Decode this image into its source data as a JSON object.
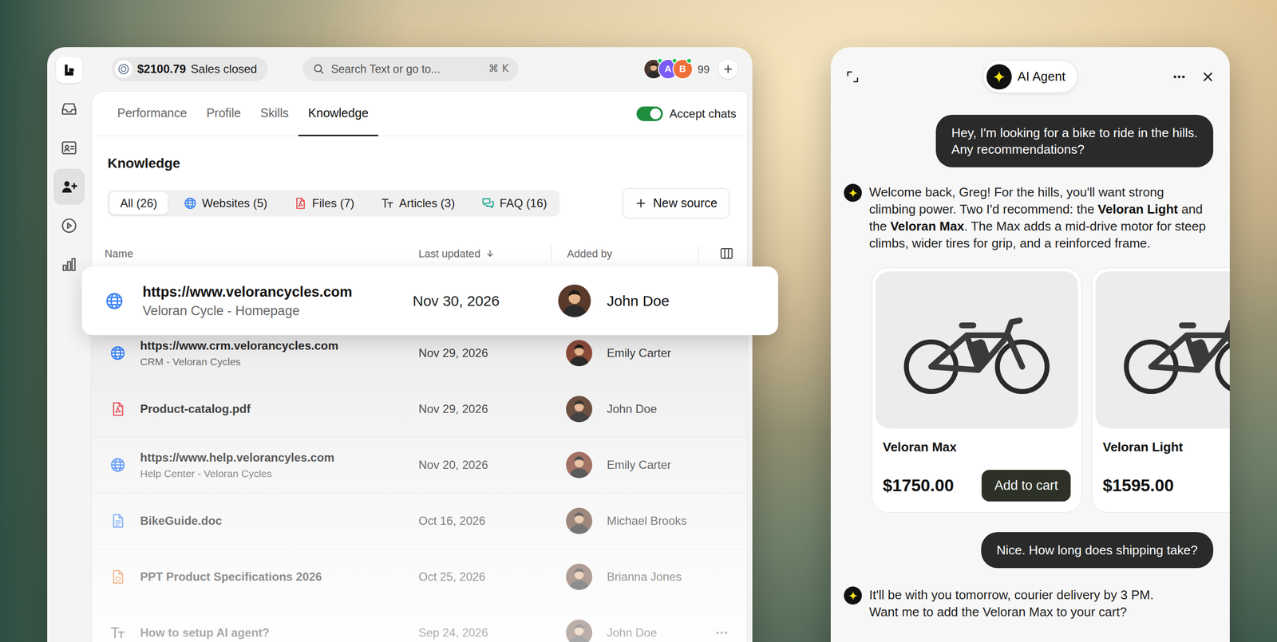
{
  "topbar": {
    "sales": {
      "amount": "$2100.79",
      "label": "Sales closed"
    },
    "search": {
      "placeholder": "Search Text or go to...",
      "shortcut": "⌘ K"
    },
    "avatars": [
      {
        "kind": "photo",
        "online": true
      },
      {
        "kind": "letter",
        "letter": "A",
        "color": "#7c5cf5",
        "online": true
      },
      {
        "kind": "letter",
        "letter": "B",
        "color": "#f0703a",
        "online": true
      }
    ],
    "avatar_count": "99"
  },
  "sidebar": {
    "items": [
      {
        "selected": false
      },
      {
        "selected": false
      },
      {
        "selected": true
      },
      {
        "selected": false
      },
      {
        "selected": false
      }
    ]
  },
  "tabs": [
    {
      "label": "Performance",
      "selected": false
    },
    {
      "label": "Profile",
      "selected": false
    },
    {
      "label": "Skills",
      "selected": false
    },
    {
      "label": "Knowledge",
      "selected": true
    }
  ],
  "accept_chats": {
    "label": "Accept chats",
    "on": true
  },
  "knowledge": {
    "title": "Knowledge",
    "filters": [
      {
        "label": "All (26)",
        "selected": true
      },
      {
        "label": "Websites (5)",
        "selected": false,
        "kind": "website"
      },
      {
        "label": "Files (7)",
        "selected": false,
        "kind": "file"
      },
      {
        "label": "Articles (3)",
        "selected": false,
        "kind": "article"
      },
      {
        "label": "FAQ (16)",
        "selected": false,
        "kind": "faq"
      }
    ],
    "new_source": "New source"
  },
  "table": {
    "columns": [
      {
        "label": "Name",
        "sort": "none"
      },
      {
        "label": "Last updated",
        "sort": "desc"
      },
      {
        "label": "Added by",
        "sort": "none"
      }
    ],
    "rows": [
      {
        "kind": "website",
        "name": "https://www.velorancycles.com",
        "subtitle": "Veloran Cycle - Homepage",
        "updated": "Nov 30, 2026",
        "added_by": "John Doe",
        "selected": true,
        "actions_visible": false
      },
      {
        "kind": "website",
        "name": "https://www.crm.velorancycles.com",
        "subtitle": "CRM - Veloran Cycles",
        "updated": "Nov 29, 2026",
        "added_by": "Emily Carter",
        "selected": false,
        "actions_visible": false
      },
      {
        "kind": "pdf",
        "name": "Product-catalog.pdf",
        "updated": "Nov 29, 2026",
        "added_by": "John Doe",
        "selected": false,
        "actions_visible": false
      },
      {
        "kind": "website",
        "name": "https://www.help.velorancyles.com",
        "subtitle": "Help Center - Veloran Cycles",
        "updated": "Nov 20, 2026",
        "added_by": "Emily Carter",
        "selected": false,
        "actions_visible": false
      },
      {
        "kind": "doc",
        "name": "BikeGuide.doc",
        "updated": "Oct 16, 2026",
        "added_by": "Michael Brooks",
        "selected": false,
        "actions_visible": false
      },
      {
        "kind": "ppt",
        "name": "PPT Product Specifications 2026",
        "updated": "Oct 25, 2026",
        "added_by": "Brianna Jones",
        "selected": false,
        "actions_visible": false
      },
      {
        "kind": "article",
        "name": "How to setup AI agent?",
        "updated": "Sep 24, 2026",
        "added_by": "John Doe",
        "selected": false,
        "actions_visible": true
      }
    ]
  },
  "chat": {
    "title": "AI Agent",
    "messages": [
      {
        "kind": "user",
        "lines": [
          "Hey, I'm looking for a bike to ride in the hills.",
          "Any recommendations?"
        ]
      },
      {
        "kind": "agent",
        "paragraphs": [
          [
            {
              "text": "Welcome back, Greg! For the hills, you'll want strong climbing power. Two I'd recommend: the ",
              "bold": false
            },
            {
              "text": "Veloran Light",
              "bold": true
            },
            {
              "text": " and the ",
              "bold": false
            },
            {
              "text": "Veloran Max",
              "bold": true
            },
            {
              "text": ". The Max adds a mid-drive motor for steep climbs, wider tires for grip, and a reinforced frame.",
              "bold": false
            }
          ]
        ]
      },
      {
        "kind": "products",
        "items": [
          {
            "name": "Veloran Max",
            "price": "$1750.00",
            "button": "Add to cart"
          },
          {
            "name": "Veloran Light",
            "price": "$1595.00"
          }
        ]
      },
      {
        "kind": "user",
        "lines": [
          "Nice. How long does shipping take?"
        ]
      },
      {
        "kind": "agent",
        "paragraphs": [
          [
            {
              "text": "It'll be with you tomorrow, courier delivery by 3 PM.",
              "bold": false
            }
          ],
          [
            {
              "text": "Want me to add the Veloran Max to your cart?",
              "bold": false
            }
          ]
        ]
      }
    ]
  }
}
